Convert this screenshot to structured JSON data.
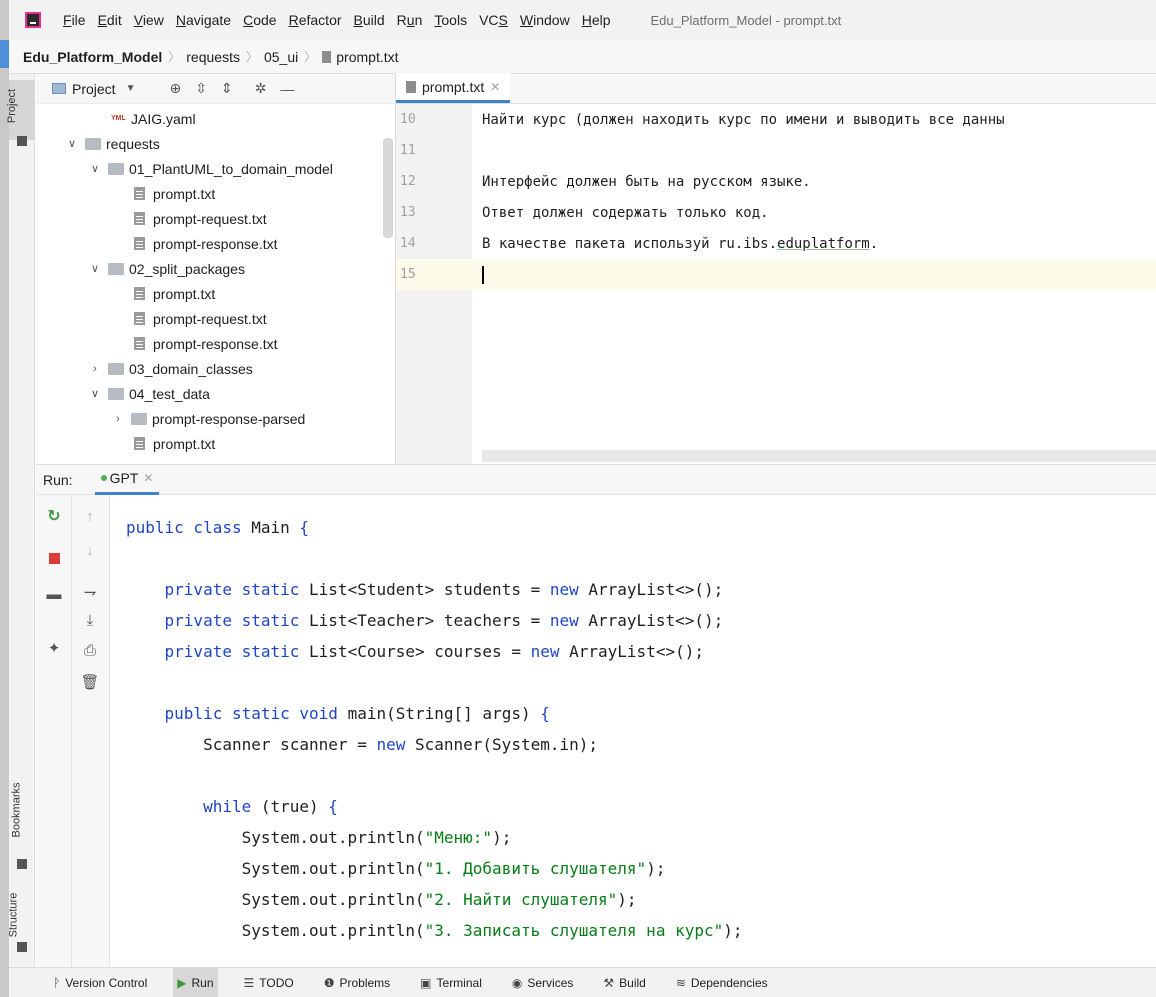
{
  "window": {
    "title": "Edu_Platform_Model - prompt.txt"
  },
  "menu": [
    {
      "pre": "",
      "u": "F",
      "post": "ile"
    },
    {
      "pre": "",
      "u": "E",
      "post": "dit"
    },
    {
      "pre": "",
      "u": "V",
      "post": "iew"
    },
    {
      "pre": "",
      "u": "N",
      "post": "avigate"
    },
    {
      "pre": "",
      "u": "C",
      "post": "ode"
    },
    {
      "pre": "",
      "u": "R",
      "post": "efactor"
    },
    {
      "pre": "",
      "u": "B",
      "post": "uild"
    },
    {
      "pre": "R",
      "u": "u",
      "post": "n"
    },
    {
      "pre": "",
      "u": "T",
      "post": "ools"
    },
    {
      "pre": "VC",
      "u": "S",
      "post": ""
    },
    {
      "pre": "",
      "u": "W",
      "post": "indow"
    },
    {
      "pre": "",
      "u": "H",
      "post": "elp"
    }
  ],
  "breadcrumb": {
    "project": "Edu_Platform_Model",
    "items": [
      "requests",
      "05_ui",
      "prompt.txt"
    ]
  },
  "left_stripe": {
    "project": "Project",
    "bookmarks": "Bookmarks",
    "structure": "Structure"
  },
  "project_panel": {
    "title": "Project",
    "tree": [
      {
        "label": "JAIG.yaml",
        "kind": "yaml",
        "indent": 3,
        "arrow": ""
      },
      {
        "label": "requests",
        "kind": "folder",
        "indent": 1,
        "arrow": "expanded"
      },
      {
        "label": "01_PlantUML_to_domain_model",
        "kind": "folder",
        "indent": 2,
        "arrow": "expanded"
      },
      {
        "label": "prompt.txt",
        "kind": "file",
        "indent": 4,
        "arrow": ""
      },
      {
        "label": "prompt-request.txt",
        "kind": "file",
        "indent": 4,
        "arrow": ""
      },
      {
        "label": "prompt-response.txt",
        "kind": "file",
        "indent": 4,
        "arrow": ""
      },
      {
        "label": "02_split_packages",
        "kind": "folder",
        "indent": 2,
        "arrow": "expanded"
      },
      {
        "label": "prompt.txt",
        "kind": "file",
        "indent": 4,
        "arrow": ""
      },
      {
        "label": "prompt-request.txt",
        "kind": "file",
        "indent": 4,
        "arrow": ""
      },
      {
        "label": "prompt-response.txt",
        "kind": "file",
        "indent": 4,
        "arrow": ""
      },
      {
        "label": "03_domain_classes",
        "kind": "folder",
        "indent": 2,
        "arrow": "collapsed"
      },
      {
        "label": "04_test_data",
        "kind": "folder",
        "indent": 2,
        "arrow": "expanded"
      },
      {
        "label": "prompt-response-parsed",
        "kind": "folder",
        "indent": 3,
        "arrow": "collapsed"
      },
      {
        "label": "prompt.txt",
        "kind": "file",
        "indent": 4,
        "arrow": ""
      }
    ]
  },
  "editor": {
    "tab": "prompt.txt",
    "lines": [
      {
        "n": "10",
        "text": "Найти курс (должен находить курс по имени и выводить все данны"
      },
      {
        "n": "11",
        "text": ""
      },
      {
        "n": "12",
        "text": "Интерфейс должен быть на русском языке."
      },
      {
        "n": "13",
        "text": "Ответ должен содержать только код."
      },
      {
        "n": "14",
        "text": "В качестве пакета используй ru.ibs.",
        "underlined": "eduplatform",
        "tail": "."
      },
      {
        "n": "15",
        "text": "",
        "current": true
      }
    ]
  },
  "run": {
    "label": "Run:",
    "tab": "GPT",
    "console": [
      [
        {
          "t": "public class ",
          "c": "kw"
        },
        {
          "t": "Main ",
          "c": ""
        },
        {
          "t": "{",
          "c": "kw"
        }
      ],
      [],
      [
        {
          "t": "    private static ",
          "c": "kw"
        },
        {
          "t": "List<Student> students = ",
          "c": ""
        },
        {
          "t": "new ",
          "c": "kw"
        },
        {
          "t": "ArrayList<>();",
          "c": ""
        }
      ],
      [
        {
          "t": "    private static ",
          "c": "kw"
        },
        {
          "t": "List<Teacher> teachers = ",
          "c": ""
        },
        {
          "t": "new ",
          "c": "kw"
        },
        {
          "t": "ArrayList<>();",
          "c": ""
        }
      ],
      [
        {
          "t": "    private static ",
          "c": "kw"
        },
        {
          "t": "List<Course> courses = ",
          "c": ""
        },
        {
          "t": "new ",
          "c": "kw"
        },
        {
          "t": "ArrayList<>();",
          "c": ""
        }
      ],
      [],
      [
        {
          "t": "    public static void ",
          "c": "kw"
        },
        {
          "t": "main(String[] args) ",
          "c": ""
        },
        {
          "t": "{",
          "c": "kw"
        }
      ],
      [
        {
          "t": "        Scanner scanner = ",
          "c": ""
        },
        {
          "t": "new ",
          "c": "kw"
        },
        {
          "t": "Scanner(System.in);",
          "c": ""
        }
      ],
      [],
      [
        {
          "t": "        while ",
          "c": "kw"
        },
        {
          "t": "(true) ",
          "c": ""
        },
        {
          "t": "{",
          "c": "kw"
        }
      ],
      [
        {
          "t": "            System.out.println(",
          "c": ""
        },
        {
          "t": "\"Меню:\"",
          "c": "str"
        },
        {
          "t": ");",
          "c": ""
        }
      ],
      [
        {
          "t": "            System.out.println(",
          "c": ""
        },
        {
          "t": "\"1. Добавить слушателя\"",
          "c": "str"
        },
        {
          "t": ");",
          "c": ""
        }
      ],
      [
        {
          "t": "            System.out.println(",
          "c": ""
        },
        {
          "t": "\"2. Найти слушателя\"",
          "c": "str"
        },
        {
          "t": ");",
          "c": ""
        }
      ],
      [
        {
          "t": "            System.out.println(",
          "c": ""
        },
        {
          "t": "\"3. Записать слушателя на курс\"",
          "c": "str"
        },
        {
          "t": ");",
          "c": ""
        }
      ]
    ]
  },
  "statusbar": [
    {
      "label": "Version Control",
      "icon": "branch-icon",
      "glyph": "ᚹ"
    },
    {
      "label": "Run",
      "icon": "run-icon",
      "glyph": "▶",
      "active": true
    },
    {
      "label": "TODO",
      "icon": "list-icon",
      "glyph": "☰"
    },
    {
      "label": "Problems",
      "icon": "problems-icon",
      "glyph": "❶"
    },
    {
      "label": "Terminal",
      "icon": "terminal-icon",
      "glyph": "▣"
    },
    {
      "label": "Services",
      "icon": "services-icon",
      "glyph": "◉"
    },
    {
      "label": "Build",
      "icon": "hammer-icon",
      "glyph": "⚒"
    },
    {
      "label": "Dependencies",
      "icon": "dependencies-icon",
      "glyph": "≋"
    }
  ]
}
